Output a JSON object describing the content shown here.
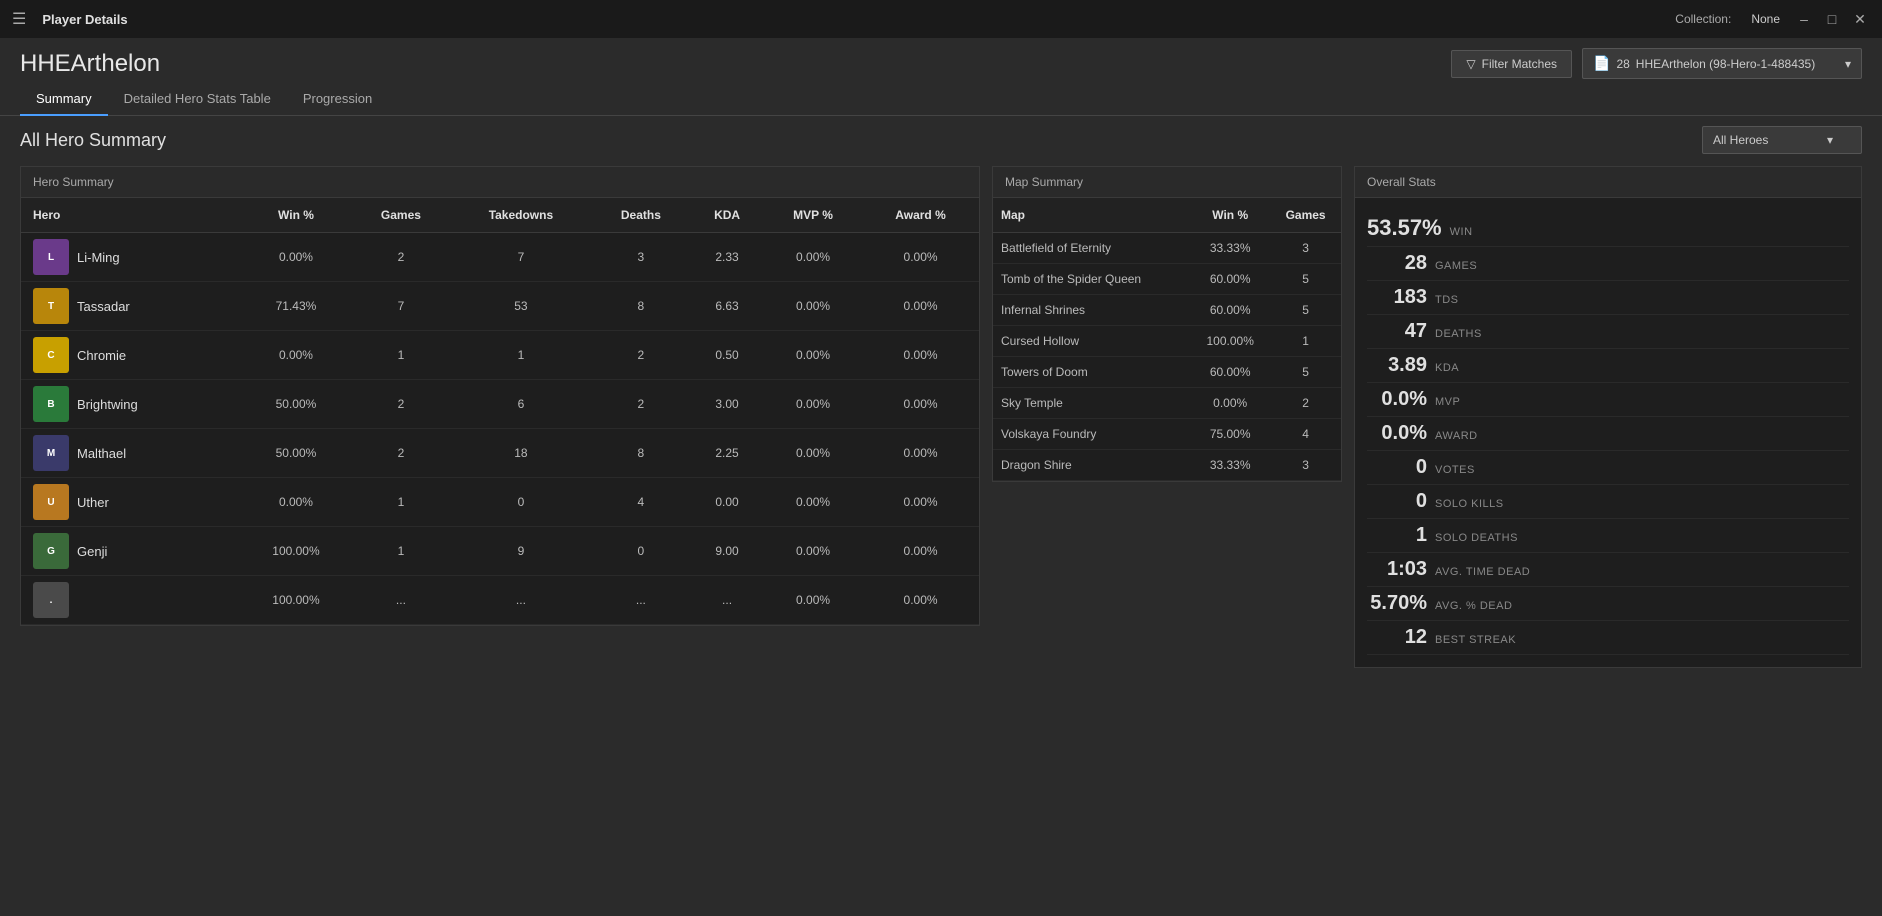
{
  "titleBar": {
    "hamburger": "☰",
    "appTitle": "Player Details",
    "collectionLabel": "Collection:",
    "collectionValue": "None",
    "windowControls": [
      "_",
      "□",
      "✕"
    ]
  },
  "playerName": "HHEArthelon",
  "filterBtn": "Filter Matches",
  "collectionDropdown": {
    "icon": "📄",
    "count": "28",
    "label": "HHEArthelon (98-Hero-1-488435)"
  },
  "tabs": [
    {
      "id": "summary",
      "label": "Summary",
      "active": true
    },
    {
      "id": "detailed",
      "label": "Detailed Hero Stats Table",
      "active": false
    },
    {
      "id": "progression",
      "label": "Progression",
      "active": false
    }
  ],
  "allHeroesDropdown": {
    "label": "All Heroes",
    "options": [
      "All Heroes"
    ]
  },
  "sectionTitle": "All Hero Summary",
  "heroSummary": {
    "panelHeader": "Hero Summary",
    "columns": [
      "Hero",
      "Win %",
      "Games",
      "Takedowns",
      "Deaths",
      "KDA",
      "MVP %",
      "Award %"
    ],
    "rows": [
      {
        "name": "Li-Ming",
        "iconClass": "icon-liming",
        "winPct": "0.00%",
        "games": "2",
        "takedowns": "7",
        "deaths": "3",
        "kda": "2.33",
        "mvpPct": "0.00%",
        "awardPct": "0.00%",
        "gamesColor": "normal"
      },
      {
        "name": "Tassadar",
        "iconClass": "icon-tassadar",
        "winPct": "71.43%",
        "games": "7",
        "takedowns": "53",
        "deaths": "8",
        "kda": "6.63",
        "mvpPct": "0.00%",
        "awardPct": "0.00%",
        "gamesColor": "normal"
      },
      {
        "name": "Chromie",
        "iconClass": "icon-chromie",
        "winPct": "0.00%",
        "games": "1",
        "takedowns": "1",
        "deaths": "2",
        "kda": "0.50",
        "mvpPct": "0.00%",
        "awardPct": "0.00%",
        "gamesColor": "teal"
      },
      {
        "name": "Brightwing",
        "iconClass": "icon-brightwing",
        "winPct": "50.00%",
        "games": "2",
        "takedowns": "6",
        "deaths": "2",
        "kda": "3.00",
        "mvpPct": "0.00%",
        "awardPct": "0.00%",
        "gamesColor": "normal"
      },
      {
        "name": "Malthael",
        "iconClass": "icon-malthael",
        "winPct": "50.00%",
        "games": "2",
        "takedowns": "18",
        "deaths": "8",
        "kda": "2.25",
        "mvpPct": "0.00%",
        "awardPct": "0.00%",
        "gamesColor": "normal"
      },
      {
        "name": "Uther",
        "iconClass": "icon-uther",
        "winPct": "0.00%",
        "games": "1",
        "takedowns": "0",
        "deaths": "4",
        "kda": "0.00",
        "mvpPct": "0.00%",
        "awardPct": "0.00%",
        "gamesColor": "teal"
      },
      {
        "name": "Genji",
        "iconClass": "icon-genji",
        "winPct": "100.00%",
        "games": "1",
        "takedowns": "9",
        "deaths": "0",
        "kda": "9.00",
        "mvpPct": "0.00%",
        "awardPct": "0.00%",
        "gamesColor": "teal"
      },
      {
        "name": "...",
        "iconClass": "icon-unknown",
        "winPct": "100.00%",
        "games": "...",
        "takedowns": "...",
        "deaths": "...",
        "kda": "...",
        "mvpPct": "0.00%",
        "awardPct": "0.00%",
        "gamesColor": "normal"
      }
    ]
  },
  "mapSummary": {
    "panelHeader": "Map Summary",
    "columns": [
      "Map",
      "Win %",
      "Games"
    ],
    "rows": [
      {
        "name": "Battlefield of Eternity",
        "winPct": "33.33%",
        "games": "3"
      },
      {
        "name": "Tomb of the Spider Queen",
        "winPct": "60.00%",
        "games": "5"
      },
      {
        "name": "Infernal Shrines",
        "winPct": "60.00%",
        "games": "5"
      },
      {
        "name": "Cursed Hollow",
        "winPct": "100.00%",
        "games": "1"
      },
      {
        "name": "Towers of Doom",
        "winPct": "60.00%",
        "games": "5"
      },
      {
        "name": "Sky Temple",
        "winPct": "0.00%",
        "games": "2"
      },
      {
        "name": "Volskaya Foundry",
        "winPct": "75.00%",
        "games": "4"
      },
      {
        "name": "Dragon Shire",
        "winPct": "33.33%",
        "games": "3"
      }
    ]
  },
  "overallStats": {
    "panelHeader": "Overall Stats",
    "stats": [
      {
        "value": "53.57%",
        "label": "WIN",
        "valueClass": "win-pct"
      },
      {
        "value": "28",
        "label": "GAMES",
        "valueClass": ""
      },
      {
        "value": "183",
        "label": "TDS",
        "valueClass": ""
      },
      {
        "value": "47",
        "label": "DEATHS",
        "valueClass": ""
      },
      {
        "value": "3.89",
        "label": "KDA",
        "valueClass": ""
      },
      {
        "value": "0.0%",
        "label": "MVP",
        "valueClass": ""
      },
      {
        "value": "0.0%",
        "label": "AWARD",
        "valueClass": ""
      },
      {
        "value": "0",
        "label": "VOTES",
        "valueClass": ""
      },
      {
        "value": "0",
        "label": "SOLO KILLS",
        "valueClass": ""
      },
      {
        "value": "1",
        "label": "SOLO DEATHS",
        "valueClass": ""
      },
      {
        "value": "1:03",
        "label": "AVG. TIME DEAD",
        "valueClass": ""
      },
      {
        "value": "5.70%",
        "label": "AVG. % DEAD",
        "valueClass": ""
      },
      {
        "value": "12",
        "label": "BEST STREAK",
        "valueClass": ""
      }
    ]
  }
}
